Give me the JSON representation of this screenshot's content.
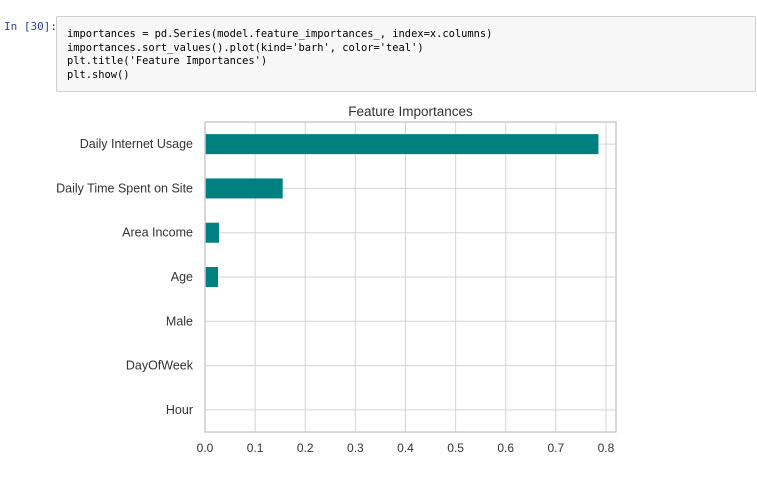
{
  "cell": {
    "prompt": "In [30]:",
    "code_lines": [
      "importances = pd.Series(model.feature_importances_, index=x.columns)",
      "importances.sort_values().plot(kind='barh', color='teal')",
      "plt.title('Feature Importances')",
      "plt.show()"
    ]
  },
  "chart_data": {
    "type": "bar",
    "orientation": "horizontal",
    "title": "Feature Importances",
    "categories": [
      "Daily Internet Usage",
      "Daily Time Spent on Site",
      "Area Income",
      "Age",
      "Male",
      "DayOfWeek",
      "Hour"
    ],
    "values": [
      0.785,
      0.155,
      0.028,
      0.026,
      0.0,
      0.0,
      0.0
    ],
    "xlim": [
      0,
      0.82
    ],
    "xticks": [
      "0.0",
      "0.1",
      "0.2",
      "0.3",
      "0.4",
      "0.5",
      "0.6",
      "0.7",
      "0.8"
    ],
    "grid": true,
    "color": "#008080"
  }
}
